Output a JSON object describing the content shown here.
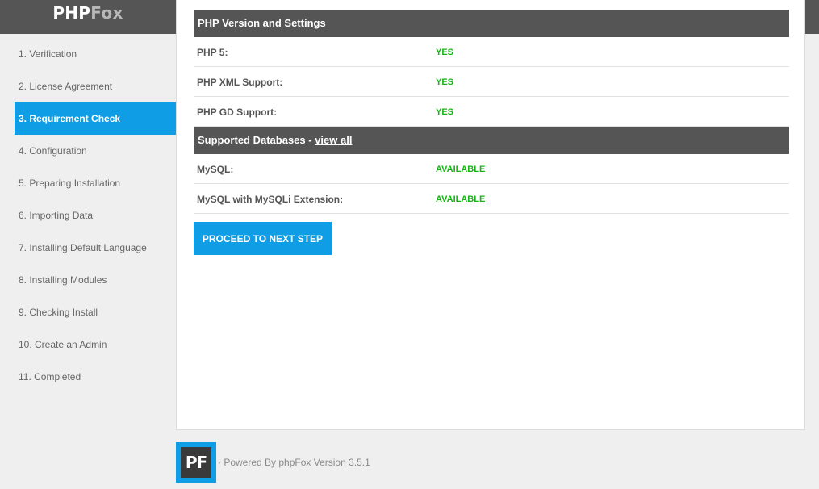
{
  "brand": {
    "logo_part1": "PHP",
    "logo_part2": "Fox"
  },
  "steps": [
    "1. Verification",
    "2. License Agreement",
    "3. Requirement Check",
    "4. Configuration",
    "5. Preparing Installation",
    "6. Importing Data",
    "7. Installing Default Language",
    "8. Installing Modules",
    "9. Checking Install",
    "10. Create an Admin",
    "11. Completed"
  ],
  "active_step_index": 2,
  "php_section": {
    "title": "PHP Version and Settings",
    "rows": [
      {
        "label": "PHP 5:",
        "value": "YES"
      },
      {
        "label": "PHP XML Support:",
        "value": "YES"
      },
      {
        "label": "PHP GD Support:",
        "value": "YES"
      }
    ]
  },
  "db_section": {
    "title": "Supported Databases - ",
    "link": "view all",
    "rows": [
      {
        "label": "MySQL:",
        "value": "AVAILABLE"
      },
      {
        "label": "MySQL with MySQLi Extension:",
        "value": "AVAILABLE"
      }
    ]
  },
  "proceed_label": "PROCEED TO NEXT STEP",
  "footer": {
    "logo_text": "PF",
    "text": "· Powered By phpFox Version 3.5.1"
  },
  "colors": {
    "accent": "#0f9ee6",
    "header": "#555555",
    "ok": "#16b316"
  }
}
